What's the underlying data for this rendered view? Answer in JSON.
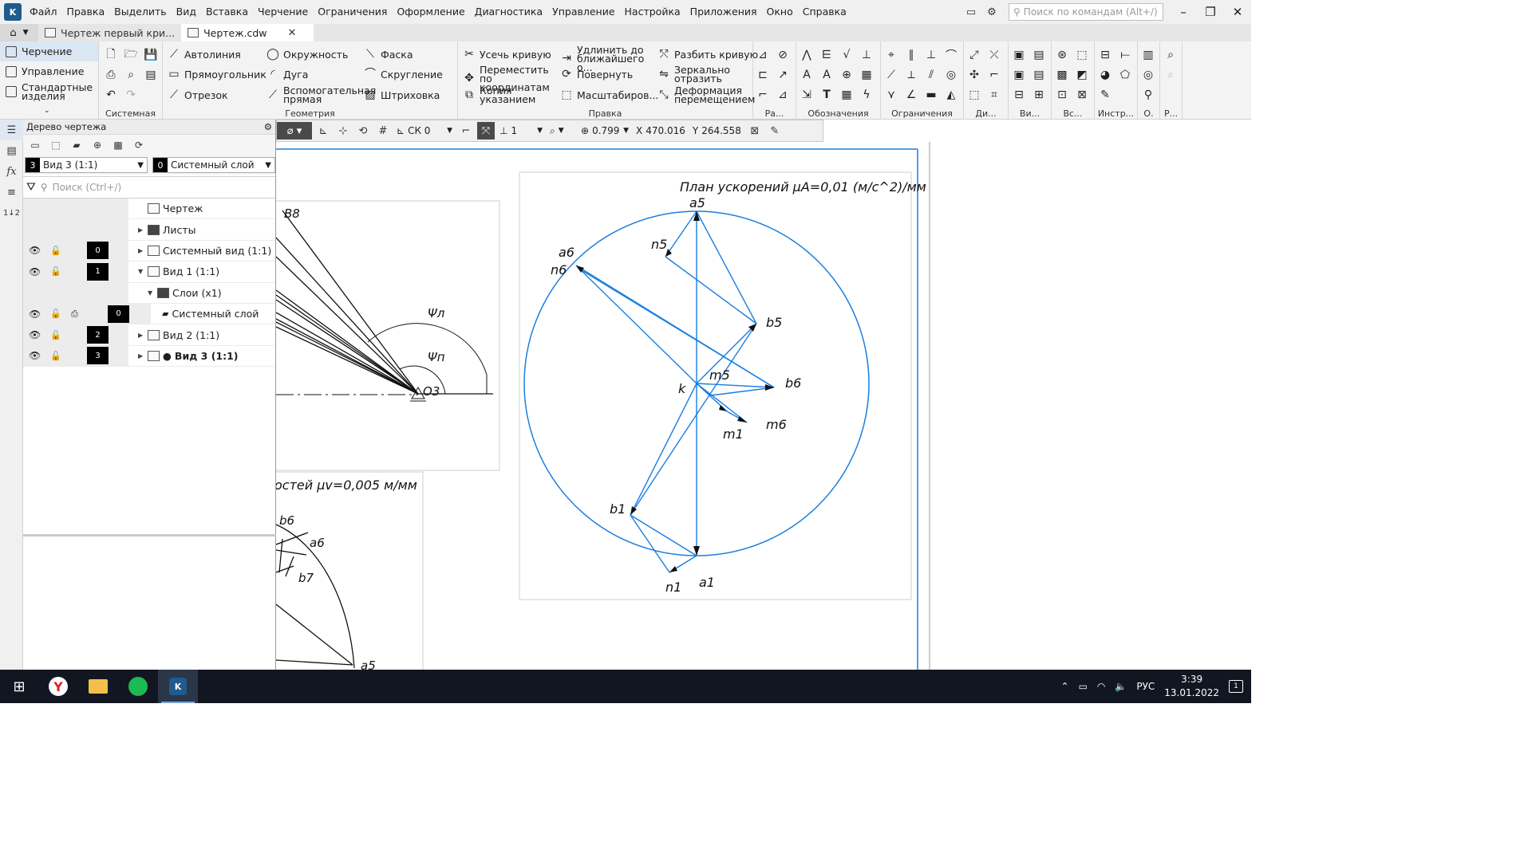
{
  "menubar": {
    "items": [
      "Файл",
      "Правка",
      "Выделить",
      "Вид",
      "Вставка",
      "Черчение",
      "Ограничения",
      "Оформление",
      "Диагностика",
      "Управление",
      "Настройка",
      "Приложения",
      "Окно",
      "Справка"
    ],
    "search_placeholder": "Поиск по командам (Alt+/)"
  },
  "tabs": [
    {
      "label": "Чертеж первый кри...",
      "active": false
    },
    {
      "label": "Чертеж.cdw",
      "active": true
    }
  ],
  "ribbon": {
    "modes": [
      "Черчение",
      "Управление",
      "Стандартные изделия"
    ],
    "groups": [
      "Системная",
      "Геометрия",
      "Правка",
      "Ра...",
      "Обозначения",
      "Ограничения",
      "Ди...",
      "Ви...",
      "Вс...",
      "Инстр...",
      "О.",
      "Р..."
    ],
    "geometry": [
      "Автолиния",
      "Окружность",
      "Фаска",
      "Прямоугольник",
      "Дуга",
      "Скругление",
      "Отрезок",
      "Вспомогательная прямая",
      "Штриховка"
    ],
    "edit": [
      "Усечь кривую",
      "Удлинить до ближайшего о...",
      "Разбить кривую",
      "Переместить по координатам",
      "Повернуть",
      "Зеркально отразить",
      "Копия указанием",
      "Масштабиров...",
      "Деформация перемещением"
    ]
  },
  "tree": {
    "title": "Дерево чертежа",
    "view_select": {
      "num": "3",
      "label": "Вид 3 (1:1)"
    },
    "layer_select": {
      "num": "0",
      "label": "Системный слой"
    },
    "search_placeholder": "Поиск (Ctrl+/)",
    "rows": [
      {
        "label": "Чертеж",
        "layer": ""
      },
      {
        "label": "Листы",
        "layer": ""
      },
      {
        "label": "Системный вид (1:1)",
        "layer": "0"
      },
      {
        "label": "Вид 1 (1:1)",
        "layer": "1"
      },
      {
        "label": "Слои (x1)",
        "layer": ""
      },
      {
        "label": "Системный слой",
        "layer": "0"
      },
      {
        "label": "Вид 2 (1:1)",
        "layer": "2"
      },
      {
        "label": "Вид 3 (1:1)",
        "layer": "3"
      }
    ]
  },
  "drawing_toolbar": {
    "cs": "СК 0",
    "step": "1",
    "zoom": "0.799",
    "x_label": "X",
    "x": "470.016",
    "y_label": "Y",
    "y": "264.558"
  },
  "drawing": {
    "accel_title": "План ускорений μA=0,01 (м/с^2)/мм",
    "vel_title": "остей μv=0,005 м/мм",
    "accel_labels": [
      "a5",
      "n5",
      "a6",
      "n6",
      "b5",
      "k",
      "m5",
      "b6",
      "m1",
      "m6",
      "b1",
      "n1",
      "a1"
    ],
    "mech_labels": [
      "B8",
      "Ψл",
      "Ψп",
      "O3"
    ],
    "vel_labels": [
      "b6",
      "a6",
      "b7",
      "a5"
    ]
  },
  "taskbar": {
    "lang": "РУС",
    "time": "3:39",
    "date": "13.01.2022",
    "notifications": "1"
  }
}
